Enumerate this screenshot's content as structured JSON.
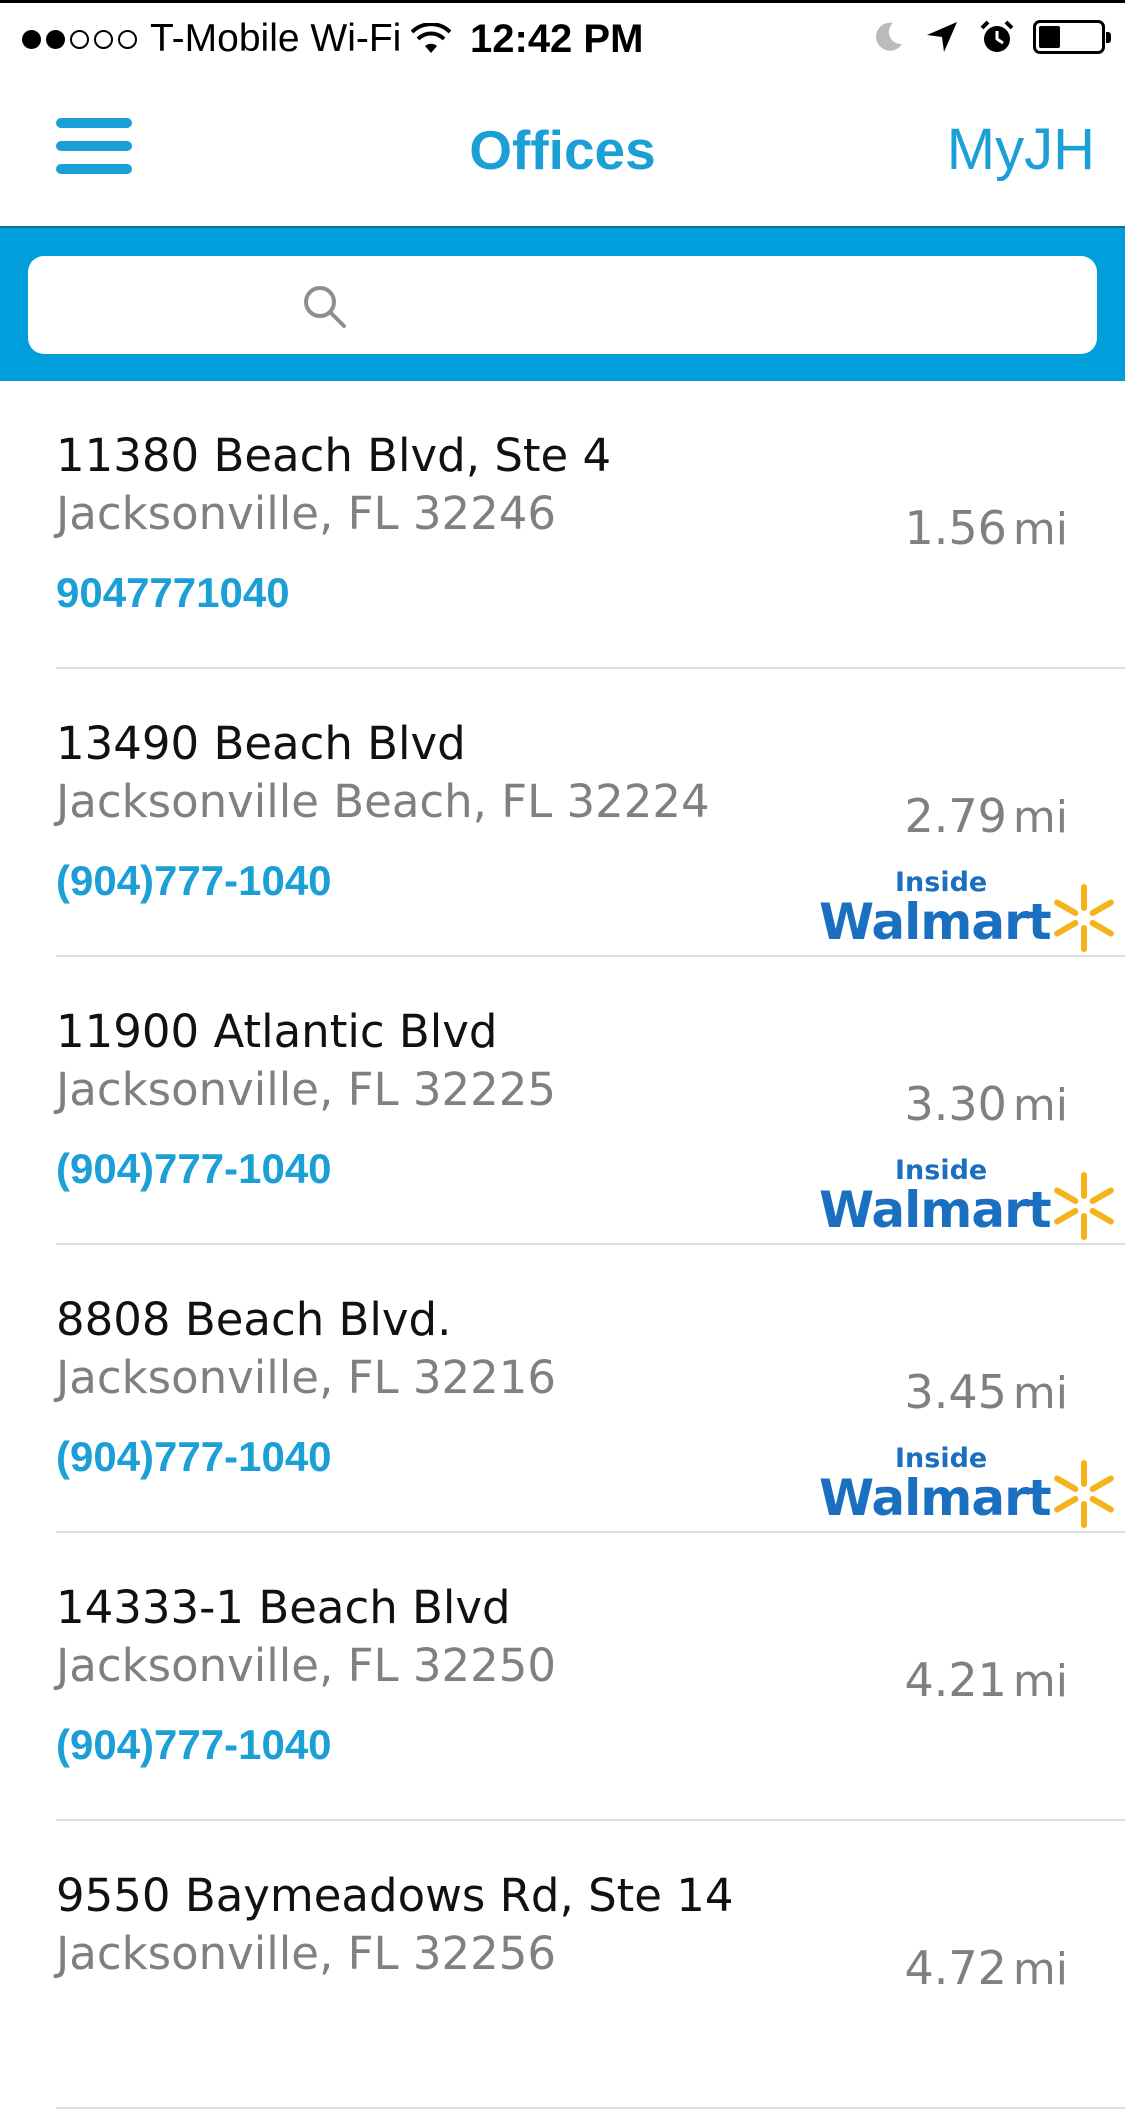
{
  "status_bar": {
    "carrier": "T-Mobile Wi-Fi",
    "time": "12:42 PM",
    "signal_full": 2,
    "signal_total": 5,
    "battery_level": 0.35
  },
  "nav": {
    "title": "Offices",
    "right_link": "MyJH",
    "menu_icon": "hamburger-icon"
  },
  "search": {
    "placeholder": "",
    "icon": "search-icon"
  },
  "colors": {
    "accent": "#1a9fd6",
    "search_band": "#009fdb",
    "walmart_blue": "#1a6fc0",
    "walmart_yellow": "#f5b31b"
  },
  "offices": [
    {
      "address1": "11380 Beach Blvd, Ste 4",
      "address2": "Jacksonville, FL 32246",
      "phone": "9047771040",
      "distance": "1.56",
      "unit": "mi",
      "walmart": false
    },
    {
      "address1": "13490 Beach Blvd",
      "address2": "Jacksonville Beach, FL 32224",
      "phone": "(904)777-1040",
      "distance": "2.79",
      "unit": "mi",
      "walmart": true,
      "walmart_inside": "Inside",
      "walmart_name": "Walmart"
    },
    {
      "address1": "11900 Atlantic Blvd",
      "address2": "Jacksonville, FL 32225",
      "phone": "(904)777-1040",
      "distance": "3.30",
      "unit": "mi",
      "walmart": true,
      "walmart_inside": "Inside",
      "walmart_name": "Walmart"
    },
    {
      "address1": "8808 Beach Blvd.",
      "address2": "Jacksonville, FL 32216",
      "phone": "(904)777-1040",
      "distance": "3.45",
      "unit": "mi",
      "walmart": true,
      "walmart_inside": "Inside",
      "walmart_name": "Walmart"
    },
    {
      "address1": "14333-1 Beach Blvd",
      "address2": "Jacksonville, FL 32250",
      "phone": "(904)777-1040",
      "distance": "4.21",
      "unit": "mi",
      "walmart": false
    },
    {
      "address1": "9550 Baymeadows Rd, Ste 14",
      "address2": "Jacksonville, FL 32256",
      "phone": "",
      "distance": "4.72",
      "unit": "mi",
      "walmart": false
    }
  ]
}
